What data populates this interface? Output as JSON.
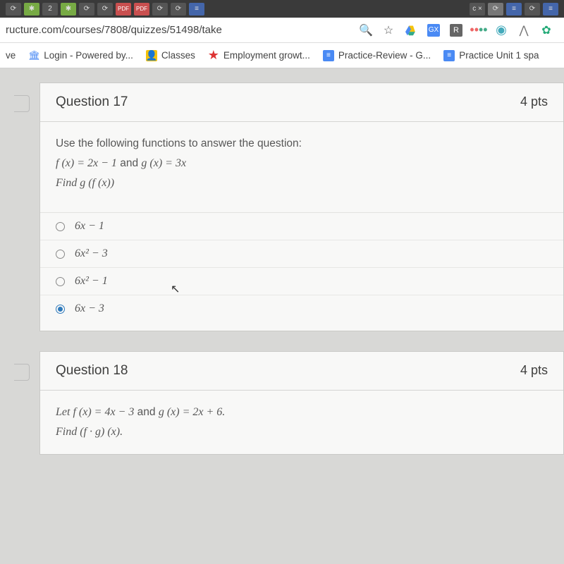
{
  "addressBar": {
    "url": "ructure.com/courses/7808/quizzes/51498/take"
  },
  "bookmarks": {
    "item0": "ve",
    "item1": "Login - Powered by...",
    "item2": "Classes",
    "item3": "Employment growt...",
    "item4": "Practice-Review - G...",
    "item5": "Practice Unit 1 spa"
  },
  "q17": {
    "title": "Question 17",
    "points": "4 pts",
    "prompt": "Use the following functions to answer the question:",
    "func_text_a": "f (x) = 2x − 1",
    "func_text_mid": " and ",
    "func_text_b": "g (x) = 3x",
    "find": "Find g (f (x))",
    "opts": {
      "a": "6x − 1",
      "b": "6x² − 3",
      "c": "6x² − 1",
      "d": "6x − 3"
    }
  },
  "q18": {
    "title": "Question 18",
    "points": "4 pts",
    "let_a": "Let f (x) = 4x − 3",
    "let_mid": " and ",
    "let_b": "g (x) = 2x + 6.",
    "find": "Find (f · g) (x)."
  }
}
